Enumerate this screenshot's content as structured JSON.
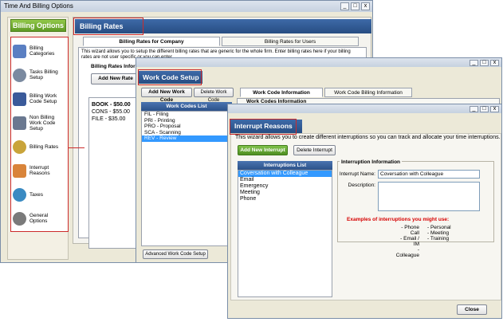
{
  "main_window": {
    "title": "Time And Billing Options",
    "controls": {
      "minimize": "_",
      "maximize": "□",
      "close": "x"
    }
  },
  "left_panel": {
    "header": "Billing Options",
    "items": [
      {
        "label": "Billing Categories",
        "icon": "book-icon",
        "color": "#5a7fc2"
      },
      {
        "label": "Tasks Billing Setup",
        "icon": "clock-icon",
        "color": "#7b8aa0"
      },
      {
        "label": "Billing Work Code Setup",
        "icon": "person-icon",
        "color": "#3a5a9a"
      },
      {
        "label": "Non Billing Work Code Setup",
        "icon": "person-icon",
        "color": "#6a7890"
      },
      {
        "label": "Billing Rates",
        "icon": "coins-icon",
        "color": "#c9a43a"
      },
      {
        "label": "Interrupt Reasons",
        "icon": "hand-icon",
        "color": "#d9843a"
      },
      {
        "label": "Taxes",
        "icon": "globe-icon",
        "color": "#3a8ac2"
      },
      {
        "label": "General Options",
        "icon": "gear-icon",
        "color": "#7a7a7a"
      }
    ]
  },
  "billing_rates": {
    "header": "Billing Rates",
    "tabs": [
      "Billing Rates for Company",
      "Billing Rates for Users"
    ],
    "description": "This wizard allows you to setup the different billing rates that are generic for the whole firm.  Enter billing rates here if your billing rates are not user specific or you can enter",
    "group_label": "Billing Rates Infor",
    "add_button": "Add New Rate",
    "rates": [
      "BOOK - $50.00",
      "CONS - $55.00",
      "FILE - $35.00"
    ]
  },
  "work_code_setup": {
    "header": "Work Code Setup",
    "add_button": "Add New Work Code",
    "delete_button": "Delete Work Code",
    "list_header": "Work Codes List",
    "items": [
      "FIL - Filing",
      "PRI - Printing",
      "PRO - Proposal",
      "SCA - Scanning",
      "REV - Review"
    ],
    "selected_index": 4,
    "tabs": [
      "Work Code Information",
      "Work Code Billing Information"
    ],
    "info_group_label": "Work Codes Information",
    "advanced_button": "Advanced Work Code Setup"
  },
  "interrupt_reasons": {
    "header": "Interrupt Reasons",
    "description": "This wizard allows you to create different interruptions so you can track and allocate your time interruptions.",
    "add_button": "Add New Interrupt",
    "delete_button": "Delete Interrupt",
    "list_header": "Interruptions List",
    "items": [
      "Coversation with Colleague",
      "Email",
      "Emergency",
      "Meeting",
      "Phone"
    ],
    "selected_index": 0,
    "info_group_label": "Interruption Information",
    "name_label": "Interrupt Name:",
    "name_value": "Coversation with Colleague",
    "description_label": "Description:",
    "description_value": "",
    "examples_title": "Examples of interruptions you might use:",
    "examples_left": [
      "- Phone Call",
      "- Email / IM",
      "- Colleague"
    ],
    "examples_right": [
      "- Personal",
      "- Meeting",
      "- Training"
    ],
    "close_button": "Close"
  }
}
